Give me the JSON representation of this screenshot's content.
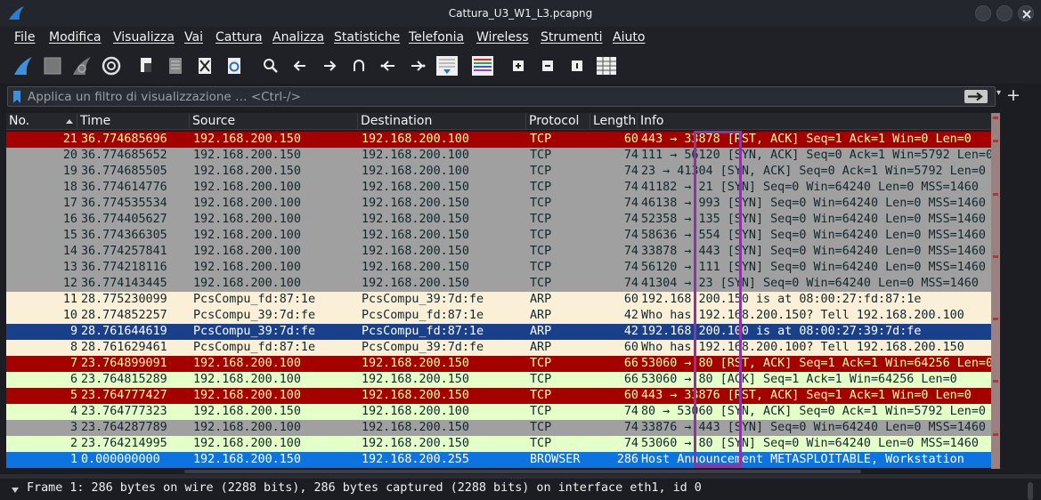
{
  "window": {
    "title": "Cattura_U3_W1_L3.pcapng"
  },
  "menu": [
    "File",
    "Modifica",
    "Visualizza",
    "Vai",
    "Cattura",
    "Analizza",
    "Statistiche",
    "Telefonia",
    "Wireless",
    "Strumenti",
    "Aiuto"
  ],
  "toolbar": {
    "buttons": [
      "start-capture-icon",
      "stop-capture-icon",
      "restart-capture-icon",
      "capture-options-icon",
      "open-file-icon",
      "save-file-icon",
      "close-file-icon",
      "reload-file-icon",
      "find-packet-icon",
      "go-back-icon",
      "go-forward-icon",
      "go-to-packet-icon",
      "go-first-packet-icon",
      "go-last-packet-icon",
      "autoscroll-icon",
      "colorize-icon",
      "zoom-in-icon",
      "zoom-out-icon",
      "zoom-normal-icon",
      "resize-columns-icon"
    ]
  },
  "filter": {
    "placeholder": "Applica un filtro di visualizzazione … <Ctrl-/>",
    "value": ""
  },
  "columns": {
    "no": "No.",
    "time": "Time",
    "source": "Source",
    "destination": "Destination",
    "protocol": "Protocol",
    "length": "Length",
    "info": "Info"
  },
  "colors": {
    "rst_bg": "#a40000",
    "rst_fg": "#fffc9c",
    "gray_bg": "#a0a0a0",
    "gray_fg": "#12272e",
    "arp_bg": "#faf0d7",
    "arp_fg": "#12272e",
    "selected_bg": "#1a3f8b",
    "selected_fg": "#ffffff",
    "http_bg": "#e4ffc7",
    "http_fg": "#12272e",
    "browser_bg": "#0d73e0",
    "browser_fg": "#ffffff",
    "highlight_border": "#8e35a6"
  },
  "packets": [
    {
      "no": "21",
      "time": "36.774685696",
      "src": "192.168.200.150",
      "dst": "192.168.200.100",
      "proto": "TCP",
      "len": "60",
      "info": "443 → 33878 [RST, ACK] Seq=1 Ack=1 Win=0 Len=0",
      "style": "rst"
    },
    {
      "no": "20",
      "time": "36.774685652",
      "src": "192.168.200.150",
      "dst": "192.168.200.100",
      "proto": "TCP",
      "len": "74",
      "info": "111 → 56120 [SYN, ACK] Seq=0 Ack=1 Win=5792 Len=0",
      "style": "gray"
    },
    {
      "no": "19",
      "time": "36.774685505",
      "src": "192.168.200.150",
      "dst": "192.168.200.100",
      "proto": "TCP",
      "len": "74",
      "info": "23 → 41304 [SYN, ACK] Seq=0 Ack=1 Win=5792 Len=0",
      "style": "gray"
    },
    {
      "no": "18",
      "time": "36.774614776",
      "src": "192.168.200.100",
      "dst": "192.168.200.150",
      "proto": "TCP",
      "len": "74",
      "info": "41182 → 21 [SYN] Seq=0 Win=64240 Len=0 MSS=1460",
      "style": "gray"
    },
    {
      "no": "17",
      "time": "36.774535534",
      "src": "192.168.200.100",
      "dst": "192.168.200.150",
      "proto": "TCP",
      "len": "74",
      "info": "46138 → 993 [SYN] Seq=0 Win=64240 Len=0 MSS=1460",
      "style": "gray"
    },
    {
      "no": "16",
      "time": "36.774405627",
      "src": "192.168.200.100",
      "dst": "192.168.200.150",
      "proto": "TCP",
      "len": "74",
      "info": "52358 → 135 [SYN] Seq=0 Win=64240 Len=0 MSS=1460",
      "style": "gray"
    },
    {
      "no": "15",
      "time": "36.774366305",
      "src": "192.168.200.100",
      "dst": "192.168.200.150",
      "proto": "TCP",
      "len": "74",
      "info": "58636 → 554 [SYN] Seq=0 Win=64240 Len=0 MSS=1460",
      "style": "gray"
    },
    {
      "no": "14",
      "time": "36.774257841",
      "src": "192.168.200.100",
      "dst": "192.168.200.150",
      "proto": "TCP",
      "len": "74",
      "info": "33878 → 443 [SYN] Seq=0 Win=64240 Len=0 MSS=1460",
      "style": "gray"
    },
    {
      "no": "13",
      "time": "36.774218116",
      "src": "192.168.200.100",
      "dst": "192.168.200.150",
      "proto": "TCP",
      "len": "74",
      "info": "56120 → 111 [SYN] Seq=0 Win=64240 Len=0 MSS=1460",
      "style": "gray"
    },
    {
      "no": "12",
      "time": "36.774143445",
      "src": "192.168.200.100",
      "dst": "192.168.200.150",
      "proto": "TCP",
      "len": "74",
      "info": "41304 → 23 [SYN] Seq=0 Win=64240 Len=0 MSS=1460",
      "style": "gray"
    },
    {
      "no": "11",
      "time": "28.775230099",
      "src": "PcsCompu_fd:87:1e",
      "dst": "PcsCompu_39:7d:fe",
      "proto": "ARP",
      "len": "60",
      "info": "192.168.200.150 is at 08:00:27:fd:87:1e",
      "style": "arp"
    },
    {
      "no": "10",
      "time": "28.774852257",
      "src": "PcsCompu_39:7d:fe",
      "dst": "PcsCompu_fd:87:1e",
      "proto": "ARP",
      "len": "42",
      "info": "Who has 192.168.200.150? Tell 192.168.200.100",
      "style": "arp"
    },
    {
      "no": "9",
      "time": "28.761644619",
      "src": "PcsCompu_39:7d:fe",
      "dst": "PcsCompu_fd:87:1e",
      "proto": "ARP",
      "len": "42",
      "info": "192.168.200.100 is at 08:00:27:39:7d:fe",
      "style": "selected"
    },
    {
      "no": "8",
      "time": "28.761629461",
      "src": "PcsCompu_fd:87:1e",
      "dst": "PcsCompu_39:7d:fe",
      "proto": "ARP",
      "len": "60",
      "info": "Who has 192.168.200.100? Tell 192.168.200.150",
      "style": "arp"
    },
    {
      "no": "7",
      "time": "23.764899091",
      "src": "192.168.200.100",
      "dst": "192.168.200.150",
      "proto": "TCP",
      "len": "66",
      "info": "53060 → 80 [RST, ACK] Seq=1 Ack=1 Win=64256 Len=0",
      "style": "rst"
    },
    {
      "no": "6",
      "time": "23.764815289",
      "src": "192.168.200.100",
      "dst": "192.168.200.150",
      "proto": "TCP",
      "len": "66",
      "info": "53060 → 80 [ACK] Seq=1 Ack=1 Win=64256 Len=0",
      "style": "http"
    },
    {
      "no": "5",
      "time": "23.764777427",
      "src": "192.168.200.100",
      "dst": "192.168.200.150",
      "proto": "TCP",
      "len": "60",
      "info": "443 → 33876 [RST, ACK] Seq=1 Ack=1 Win=0 Len=0",
      "style": "rst"
    },
    {
      "no": "4",
      "time": "23.764777323",
      "src": "192.168.200.150",
      "dst": "192.168.200.100",
      "proto": "TCP",
      "len": "74",
      "info": "80 → 53060 [SYN, ACK] Seq=0 Ack=1 Win=5792 Len=0",
      "style": "http"
    },
    {
      "no": "3",
      "time": "23.764287789",
      "src": "192.168.200.100",
      "dst": "192.168.200.150",
      "proto": "TCP",
      "len": "74",
      "info": "33876 → 443 [SYN] Seq=0 Win=64240 Len=0 MSS=1460",
      "style": "gray"
    },
    {
      "no": "2",
      "time": "23.764214995",
      "src": "192.168.200.100",
      "dst": "192.168.200.150",
      "proto": "TCP",
      "len": "74",
      "info": "53060 → 80 [SYN] Seq=0 Win=64240 Len=0 MSS=1460",
      "style": "http"
    },
    {
      "no": "1",
      "time": "0.000000000",
      "src": "192.168.200.150",
      "dst": "192.168.200.255",
      "proto": "BROWSER",
      "len": "286",
      "info": "Host Announcement METASPLOITABLE, Workstation",
      "style": "browser"
    }
  ],
  "details": {
    "frame_line": "Frame 1: 286 bytes on wire (2288 bits), 286 bytes captured (2288 bits) on interface eth1, id 0"
  }
}
